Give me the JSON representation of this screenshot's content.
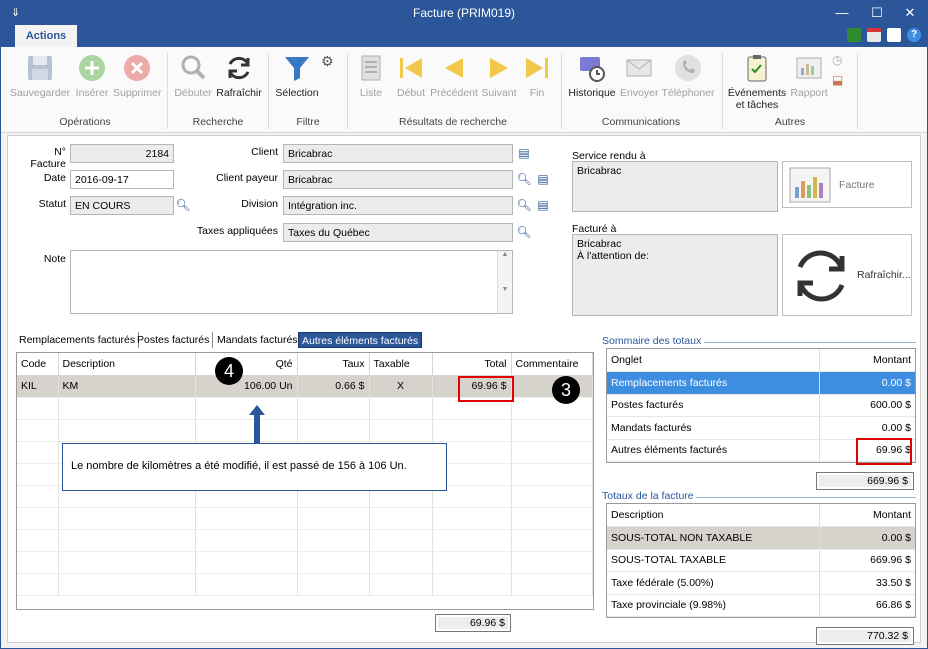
{
  "window": {
    "title": "Facture (PRIM019)"
  },
  "ribbon": {
    "tab": "Actions",
    "groups": {
      "operations": "Opérations",
      "recherche": "Recherche",
      "filtre": "Filtre",
      "resultats": "Résultats de recherche",
      "communications": "Communications",
      "autres": "Autres"
    },
    "buttons": {
      "sauvegarder": "Sauvegarder",
      "inserer": "Insérer",
      "supprimer": "Supprimer",
      "debuter": "Débuter",
      "rafraichir": "Rafraîchir",
      "selection": "Sélection",
      "liste": "Liste",
      "debut": "Début",
      "precedent": "Précédent",
      "suivant": "Suivant",
      "fin": "Fin",
      "historique": "Historique",
      "envoyer": "Envoyer",
      "telephoner": "Téléphoner",
      "evenements_1": "Événements",
      "evenements_2": "et tâches",
      "rapport": "Rapport"
    }
  },
  "form": {
    "no_facture_label": "N° Facture",
    "no_facture": "2184",
    "date_label": "Date",
    "date": "2016-09-17",
    "statut_label": "Statut",
    "statut": "EN COURS",
    "client_label": "Client",
    "client": "Bricabrac",
    "client_payeur_label": "Client payeur",
    "client_payeur": "Bricabrac",
    "division_label": "Division",
    "division": "Intégration inc.",
    "taxes_label": "Taxes appliquées",
    "taxes": "Taxes du Québec",
    "note_label": "Note",
    "service_rendu_label": "Service rendu à",
    "service_rendu": "Bricabrac",
    "facture_btn": "Facture",
    "facture_a_label": "Facturé à",
    "facture_a_1": "Bricabrac",
    "facture_a_2": "À l'attention de:",
    "rafraichir_btn": "Rafraîchir..."
  },
  "tabs": {
    "t1": "Remplacements facturés",
    "t2": "Postes facturés",
    "t3": "Mandats facturés",
    "t4": "Autres éléments facturés"
  },
  "grid": {
    "headers": {
      "code": "Code",
      "description": "Description",
      "qte": "Qté",
      "taux": "Taux",
      "taxable": "Taxable",
      "total": "Total",
      "commentaire": "Commentaire"
    },
    "row": {
      "code": "KIL",
      "description": "KM",
      "qte": "106.00 Un",
      "taux": "0.66 $",
      "taxable": "X",
      "total": "69.96 $"
    },
    "footer_total": "69.96 $"
  },
  "callouts": {
    "c3": "3",
    "c4": "4"
  },
  "annotation": "Le nombre de kilomètres a été modifié, il est passé de 156 à 106 Un.",
  "sommaire": {
    "title": "Sommaire des totaux",
    "headers": {
      "onglet": "Onglet",
      "montant": "Montant"
    },
    "rows": [
      {
        "onglet": "Remplacements facturés",
        "montant": "0.00 $"
      },
      {
        "onglet": "Postes facturés",
        "montant": "600.00 $"
      },
      {
        "onglet": "Mandats facturés",
        "montant": "0.00 $"
      },
      {
        "onglet": "Autres éléments facturés",
        "montant": "69.96 $"
      }
    ],
    "total": "669.96 $"
  },
  "totaux": {
    "title": "Totaux de la facture",
    "headers": {
      "description": "Description",
      "montant": "Montant"
    },
    "rows": [
      {
        "description": "SOUS-TOTAL NON TAXABLE",
        "montant": "0.00 $"
      },
      {
        "description": "SOUS-TOTAL TAXABLE",
        "montant": "669.96 $"
      },
      {
        "description": "Taxe fédérale (5.00%)",
        "montant": "33.50 $"
      },
      {
        "description": "Taxe provinciale (9.98%)",
        "montant": "66.86 $"
      }
    ],
    "total": "770.32 $"
  }
}
